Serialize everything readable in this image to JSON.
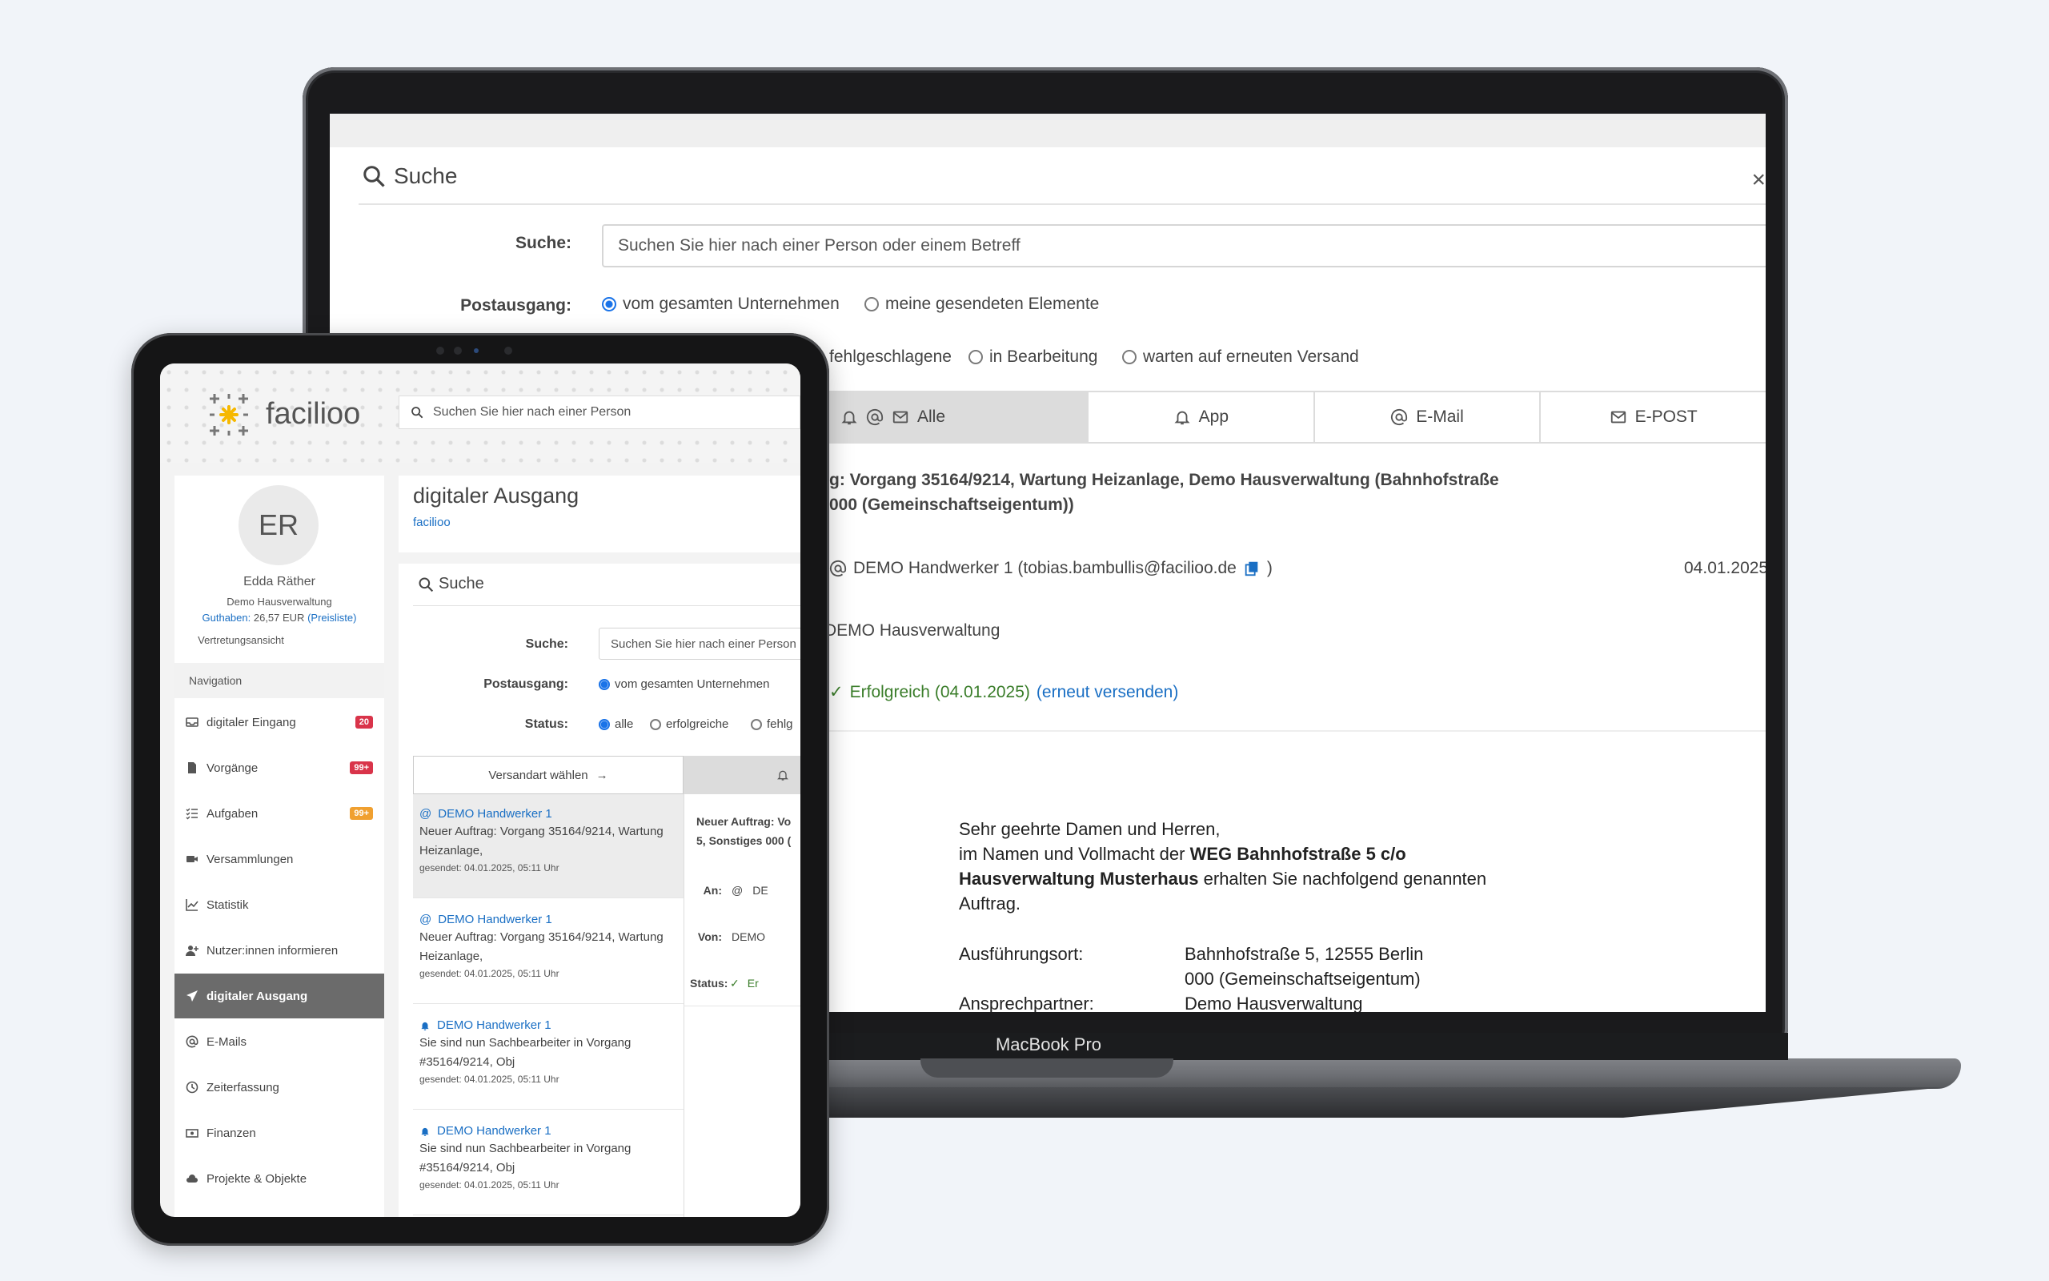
{
  "laptop": {
    "model_label": "MacBook Pro",
    "dialog_title": "Suche",
    "close_icon": "×",
    "search_label": "Suche:",
    "search_placeholder": "Suchen Sie hier nach einer Person oder einem Betreff",
    "postausgang_label": "Postausgang:",
    "postausgang_opt1": "vom gesamten Unternehmen",
    "postausgang_opt2": "meine gesendeten Elemente",
    "status_opts": [
      "fehlgeschlagene",
      "in Bearbeitung",
      "warten auf erneuten Versand"
    ],
    "tabs": {
      "all": "Alle",
      "app": "App",
      "email": "E-Mail",
      "epost": "E-POST"
    },
    "subject_line1": "g: Vorgang 35164/9214, Wartung Heizanlage, Demo Hausverwaltung (Bahnhofstraße",
    "subject_line2": "000 (Gemeinschaftseigentum))",
    "to_text": "DEMO Handwerker 1 (tobias.bambullis@facilioo.de",
    "to_close": ")",
    "to_date": "04.01.2025",
    "from_text": "DEMO Hausverwaltung",
    "status_text": "Erfolgreich (04.01.2025)",
    "resend_link": "(erneut versenden)",
    "letter": {
      "greeting": "Sehr geehrte Damen und Herren,",
      "line2_a": "im Namen und Vollmacht der ",
      "line2_b": "WEG Bahnhofstraße 5 c/o",
      "line3_a": "Hausverwaltung Musterhaus",
      "line3_b": " erhalten Sie nachfolgend genannten",
      "line4": "Auftrag.",
      "place_label": "Ausführungsort:",
      "place_value1": "Bahnhofstraße 5, 12555 Berlin",
      "place_value2": "000 (Gemeinschaftseigentum)",
      "contact_label": "Ansprechpartner:",
      "contact_value": "Demo Hausverwaltung"
    }
  },
  "tablet": {
    "logo_text": "facilioo",
    "search_placeholder": "Suchen Sie hier nach einer Person",
    "user": {
      "initials": "ER",
      "name": "Edda Räther",
      "company": "Demo Hausverwaltung",
      "credit_label": "Guthaben:",
      "credit_value": "26,57 EUR",
      "price_list": "(Preisliste)",
      "proxy_view": "Vertretungsansicht"
    },
    "nav_header": "Navigation",
    "nav": [
      {
        "label": "digitaler Eingang",
        "badge": "20"
      },
      {
        "label": "Vorgänge",
        "badge": "99+"
      },
      {
        "label": "Aufgaben",
        "badge": "99+"
      },
      {
        "label": "Versammlungen",
        "badge": ""
      },
      {
        "label": "Statistik",
        "badge": ""
      },
      {
        "label": "Nutzer:innen informieren",
        "badge": ""
      },
      {
        "label": "digitaler Ausgang",
        "badge": ""
      },
      {
        "label": "E-Mails",
        "badge": ""
      },
      {
        "label": "Zeiterfassung",
        "badge": ""
      },
      {
        "label": "Finanzen",
        "badge": ""
      },
      {
        "label": "Projekte & Objekte",
        "badge": ""
      }
    ],
    "page_title": "digitaler Ausgang",
    "breadcrumb": "facilioo",
    "card_title": "Suche",
    "search_label": "Suche:",
    "postausgang_label": "Postausgang:",
    "postausgang_opt1": "vom gesamten Unternehmen",
    "status_label": "Status:",
    "status_opts": [
      "alle",
      "erfolgreiche",
      "fehlg"
    ],
    "select_type": "Versandart wählen",
    "detail": {
      "subject1": "Neuer Auftrag: Vo",
      "subject2": "5, Sonstiges 000 (",
      "to_label": "An:",
      "to_value": "DE",
      "from_label": "Von:",
      "from_value": "DEMO",
      "status_label": "Status:",
      "status_value": "Er"
    },
    "messages": [
      {
        "from": "DEMO Handwerker 1",
        "line1": "Neuer Auftrag: Vorgang 35164/9214, Wartung",
        "line2": "Heizanlage,",
        "date": "gesendet: 04.01.2025, 05:11 Uhr"
      },
      {
        "from": "DEMO Handwerker 1",
        "line1": "Neuer Auftrag: Vorgang 35164/9214, Wartung",
        "line2": "Heizanlage,",
        "date": "gesendet: 04.01.2025, 05:11 Uhr"
      },
      {
        "from": "DEMO Handwerker 1",
        "line1": "Sie sind nun Sachbearbeiter in Vorgang",
        "line2": "#35164/9214, Obj",
        "date": "gesendet: 04.01.2025, 05:11 Uhr"
      },
      {
        "from": "DEMO Handwerker 1",
        "line1": "Sie sind nun Sachbearbeiter in Vorgang",
        "line2": "#35164/9214, Obj",
        "date": "gesendet: 04.01.2025, 05:11 Uhr"
      }
    ]
  },
  "colors": {
    "accent": "#1a73e8",
    "link": "#1a6fc4",
    "success": "#3a7d2a",
    "badge_red": "#d9344a",
    "badge_orange": "#f0a030",
    "logo_yellow": "#f6b800"
  }
}
